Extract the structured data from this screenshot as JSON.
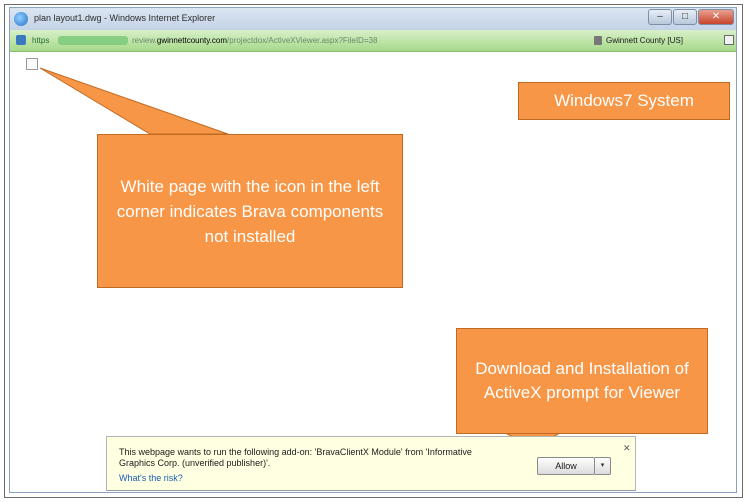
{
  "window": {
    "title": "plan layout1.dwg - Windows Internet Explorer",
    "minimize_label": "–",
    "maximize_label": "□",
    "close_label": "✕"
  },
  "address": {
    "scheme": "https",
    "domain": "gwinnettcounty.com",
    "path_prefix": "review.",
    "path": "/projectdox/ActiveXViewer.aspx?FileID=38",
    "site_identity": "Gwinnett County [US]"
  },
  "callouts": {
    "system": "Windows7 System",
    "white_page": "White page with the icon in the left corner indicates Brava components not installed",
    "download": "Download and Installation of ActiveX prompt for Viewer"
  },
  "infobar": {
    "message": "This webpage wants to run the following add-on: 'BravaClientX Module' from 'Informative Graphics Corp. (unverified publisher)'.",
    "risk_link": "What's the risk?",
    "allow_label": "Allow",
    "dropdown_label": "▾",
    "close_label": "✕"
  },
  "colors": {
    "callout": "#f79646",
    "addressbar": "#a6d98a",
    "infobar": "#ffffe1"
  }
}
